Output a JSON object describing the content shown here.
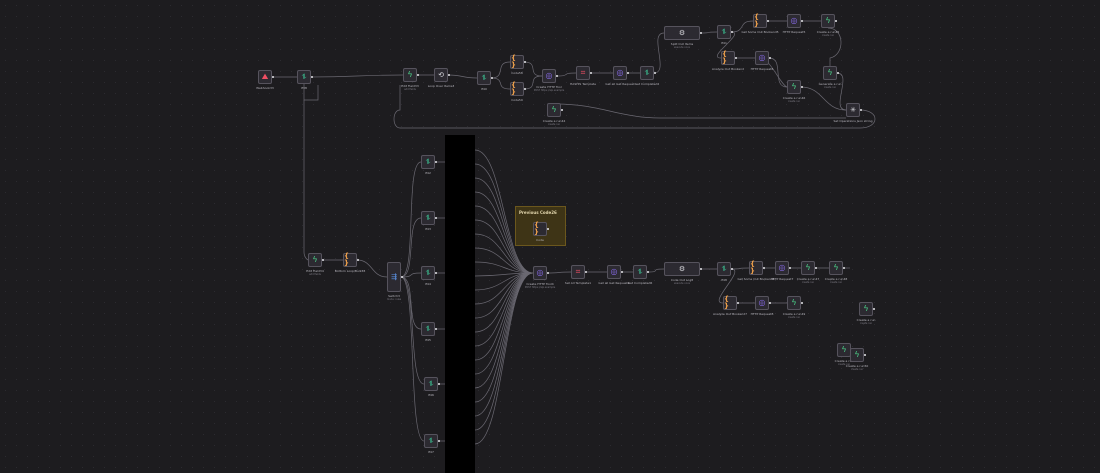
{
  "canvas": {
    "background": "#1d1c1f",
    "wire_color": "#6b6972",
    "accent": {
      "code": "#f0a14a",
      "bolt": "#4cd38a",
      "if": "#3ed39e",
      "http": "#8c6df0",
      "trigger": "#ef4e63"
    }
  },
  "sticky_note": {
    "title": "Previous Code26"
  },
  "nodes": [
    {
      "id": "n1",
      "label": "Webhook33",
      "sub": "",
      "icon": "trigger-icon",
      "glyph": "⛰"
    },
    {
      "id": "n2",
      "label": "If38",
      "sub": "",
      "icon": "if-icon",
      "glyph": "⥮"
    },
    {
      "id": "n3",
      "label": "Edit Field33",
      "sub": "add fields",
      "icon": "bolt-icon",
      "glyph": "ϟ"
    },
    {
      "id": "n4",
      "label": "Loop Over Items3",
      "sub": "",
      "icon": "loop-icon",
      "glyph": "⟲"
    },
    {
      "id": "n5",
      "label": "If40",
      "sub": "",
      "icon": "if-icon",
      "glyph": "⥮"
    },
    {
      "id": "n6",
      "label": "Code58",
      "sub": "",
      "icon": "code-icon",
      "glyph": "{ }"
    },
    {
      "id": "n7",
      "label": "Code59",
      "sub": "",
      "icon": "code-icon",
      "glyph": "{ }"
    },
    {
      "id": "n8",
      "label": "Create HTTP Tool",
      "sub": "POST https://api.example",
      "icon": "http-icon",
      "glyph": "◎"
    },
    {
      "id": "n9",
      "label": "Create a run44",
      "sub": "create run",
      "icon": "bolt-icon",
      "glyph": "ϟ"
    },
    {
      "id": "n10",
      "label": "HASHIS Template",
      "sub": "",
      "icon": "hash-icon",
      "glyph": "⌗"
    },
    {
      "id": "n11",
      "label": "Get all Get Request",
      "sub": "",
      "icon": "http-icon",
      "glyph": "◎"
    },
    {
      "id": "n12",
      "label": "Get Completed2",
      "sub": "",
      "icon": "if-icon",
      "glyph": "⥮"
    },
    {
      "id": "n13",
      "label": "Split Out Items",
      "sub": "execute once",
      "icon": "openai-icon",
      "glyph": "⚙"
    },
    {
      "id": "n14",
      "label": "If41",
      "sub": "",
      "icon": "if-icon",
      "glyph": "⥮"
    },
    {
      "id": "n15",
      "label": "Get Some Out Bookend5",
      "sub": "",
      "icon": "code-icon",
      "glyph": "{ }"
    },
    {
      "id": "n16",
      "label": "HTTP Request5",
      "sub": "",
      "icon": "http-icon",
      "glyph": "◎"
    },
    {
      "id": "n17",
      "label": "Create a run45",
      "sub": "create run",
      "icon": "bolt-icon",
      "glyph": "ϟ"
    },
    {
      "id": "n18",
      "label": "Analyze Out Bookend",
      "sub": "",
      "icon": "code-icon",
      "glyph": "{ }"
    },
    {
      "id": "n19",
      "label": "HTTP Request6",
      "sub": "",
      "icon": "http-icon",
      "glyph": "◎"
    },
    {
      "id": "n20",
      "label": "Create a run46",
      "sub": "create run",
      "icon": "bolt-icon",
      "glyph": "ϟ"
    },
    {
      "id": "n21",
      "label": "Generate a run",
      "sub": "create run",
      "icon": "bolt-icon",
      "glyph": "ϟ"
    },
    {
      "id": "n22",
      "label": "Set Operations Json string",
      "sub": "",
      "icon": "gear-icon",
      "glyph": "✳"
    },
    {
      "id": "n23",
      "label": "Edit Field34",
      "sub": "add fields",
      "icon": "bolt-icon",
      "glyph": "ϟ"
    },
    {
      "id": "n24",
      "label": "Bottom Loop/Bulk38",
      "sub": "",
      "icon": "code-icon",
      "glyph": "{ }"
    },
    {
      "id": "n25",
      "label": "Switch3",
      "sub": "mode: rules",
      "icon": "switch-icon",
      "glyph": "⇶"
    },
    {
      "id": "n26",
      "label": "If42",
      "sub": "",
      "icon": "if-icon",
      "glyph": "⥮"
    },
    {
      "id": "n27",
      "label": "If43",
      "sub": "",
      "icon": "if-icon",
      "glyph": "⥮"
    },
    {
      "id": "n28",
      "label": "If44",
      "sub": "",
      "icon": "if-icon",
      "glyph": "⥮"
    },
    {
      "id": "n29",
      "label": "If45",
      "sub": "",
      "icon": "if-icon",
      "glyph": "⥮"
    },
    {
      "id": "n30",
      "label": "If46",
      "sub": "",
      "icon": "if-icon",
      "glyph": "⥮"
    },
    {
      "id": "n31",
      "label": "If47",
      "sub": "",
      "icon": "if-icon",
      "glyph": "⥮"
    },
    {
      "id": "n32",
      "label": "Code",
      "sub": "",
      "icon": "code-icon",
      "glyph": "{ }"
    },
    {
      "id": "n33",
      "label": "Create HTTP Tool4",
      "sub": "POST https://api.example",
      "icon": "http-icon",
      "glyph": "◎"
    },
    {
      "id": "n34",
      "label": "Set All Template1",
      "sub": "",
      "icon": "hash-icon",
      "glyph": "⌗"
    },
    {
      "id": "n35",
      "label": "Get all Get Request2",
      "sub": "",
      "icon": "http-icon",
      "glyph": "◎"
    },
    {
      "id": "n36",
      "label": "Get Completed6",
      "sub": "",
      "icon": "if-icon",
      "glyph": "⥮"
    },
    {
      "id": "n37",
      "label": "Code Out Log8",
      "sub": "execute once",
      "icon": "openai-icon",
      "glyph": "⚙"
    },
    {
      "id": "n38",
      "label": "If48",
      "sub": "",
      "icon": "if-icon",
      "glyph": "⥮"
    },
    {
      "id": "n39",
      "label": "Get Some Out Bookend6",
      "sub": "",
      "icon": "code-icon",
      "glyph": "{ }"
    },
    {
      "id": "n40",
      "label": "HTTP Request7",
      "sub": "",
      "icon": "http-icon",
      "glyph": "◎"
    },
    {
      "id": "n41",
      "label": "Create a run47",
      "sub": "create run",
      "icon": "bolt-icon",
      "glyph": "ϟ"
    },
    {
      "id": "n42",
      "label": "Create a run48",
      "sub": "create run",
      "icon": "bolt-icon",
      "glyph": "ϟ"
    },
    {
      "id": "n43",
      "label": "Analyze Out Bookend7",
      "sub": "",
      "icon": "code-icon",
      "glyph": "{ }"
    },
    {
      "id": "n44",
      "label": "HTTP Request8",
      "sub": "",
      "icon": "http-icon",
      "glyph": "◎"
    },
    {
      "id": "n45",
      "label": "Create a run49",
      "sub": "create run",
      "icon": "bolt-icon",
      "glyph": "ϟ"
    },
    {
      "id": "n46",
      "label": "Create a run",
      "sub": "create run",
      "icon": "bolt-icon",
      "glyph": "ϟ"
    },
    {
      "id": "n47",
      "label": "Create a run",
      "sub": "create run",
      "icon": "bolt-icon",
      "glyph": "ϟ"
    },
    {
      "id": "n48",
      "label": "Create a run50",
      "sub": "create run",
      "icon": "bolt-icon",
      "glyph": "ϟ"
    }
  ]
}
